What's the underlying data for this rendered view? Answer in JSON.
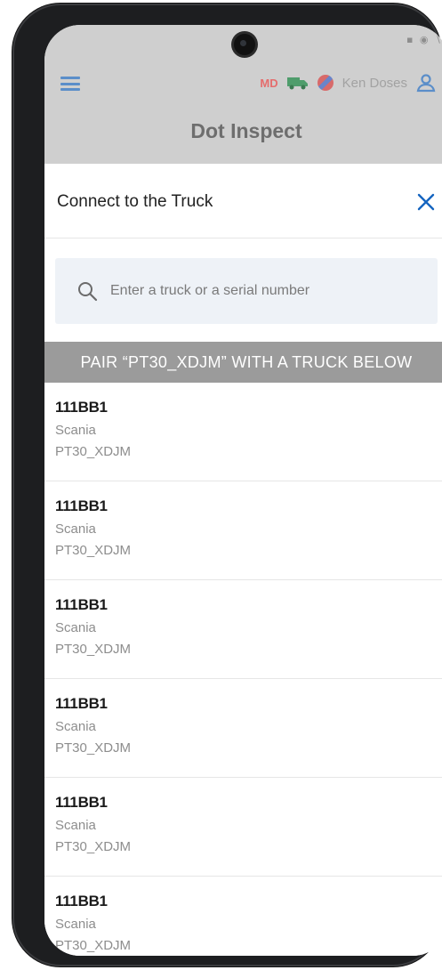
{
  "app_header": {
    "title": "Dot Inspect",
    "md_badge": "MD",
    "user_name": "Ken Doses",
    "status_icons": "▪ ◉ ∖"
  },
  "dialog": {
    "title": "Connect to the Truck",
    "search_placeholder": "Enter a truck or a serial number",
    "search_value": "",
    "pair_banner": "PAIR “PT30_XDJM” WITH A TRUCK BELOW"
  },
  "trucks": [
    {
      "id": "111BB1",
      "make": "Scania",
      "serial": "PT30_XDJM"
    },
    {
      "id": "111BB1",
      "make": "Scania",
      "serial": "PT30_XDJM"
    },
    {
      "id": "111BB1",
      "make": "Scania",
      "serial": "PT30_XDJM"
    },
    {
      "id": "111BB1",
      "make": "Scania",
      "serial": "PT30_XDJM"
    },
    {
      "id": "111BB1",
      "make": "Scania",
      "serial": "PT30_XDJM"
    },
    {
      "id": "111BB1",
      "make": "Scania",
      "serial": "PT30_XDJM"
    }
  ],
  "colors": {
    "accent": "#1565c0",
    "banner": "#9b9b9b",
    "search_bg": "#eef2f7"
  },
  "icons": {
    "menu": "hamburger-icon",
    "truck": "truck-icon",
    "flag": "flag-icon",
    "user": "user-icon",
    "close": "close-icon",
    "search": "search-icon"
  }
}
